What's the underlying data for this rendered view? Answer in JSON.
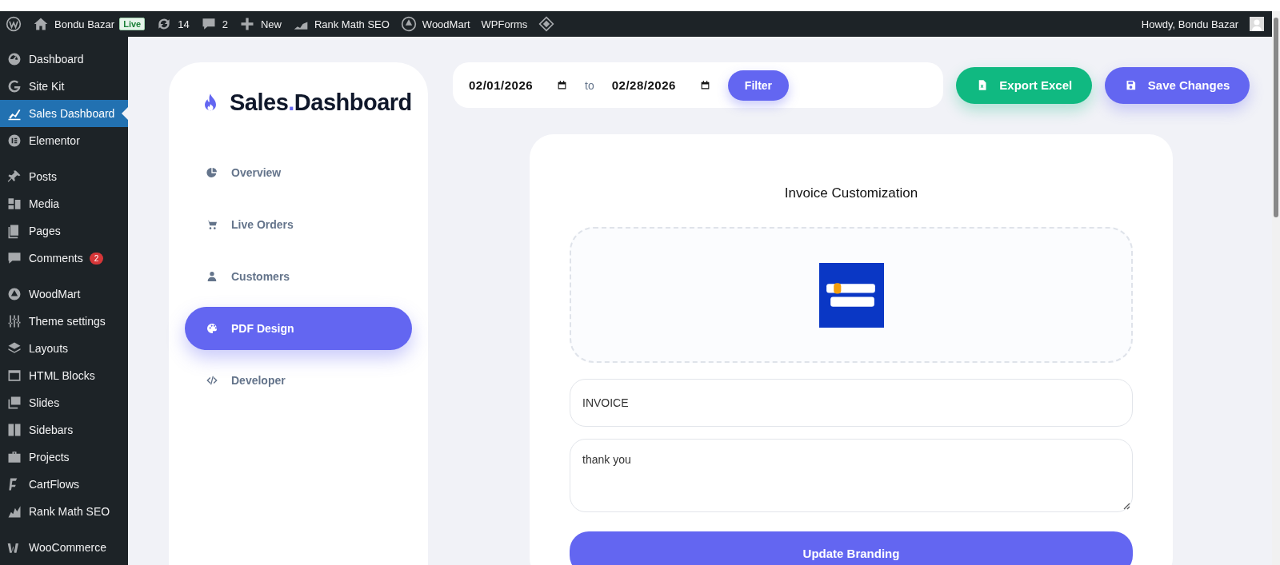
{
  "admin_bar": {
    "site": "Bondu Bazar",
    "live_badge": "Live",
    "updates": "14",
    "comments": "2",
    "new": "New",
    "links": [
      "Rank Math SEO",
      "WoodMart",
      "WPForms"
    ],
    "greeting": "Howdy, Bondu Bazar"
  },
  "admin_menu": [
    {
      "items": [
        {
          "label": "Dashboard",
          "selected": false
        },
        {
          "label": "Site Kit",
          "selected": false
        },
        {
          "label": "Sales Dashboard",
          "selected": true
        },
        {
          "label": "Elementor",
          "selected": false
        }
      ]
    },
    {
      "items": [
        {
          "label": "Posts",
          "selected": false
        },
        {
          "label": "Media",
          "selected": false
        },
        {
          "label": "Pages",
          "selected": false
        },
        {
          "label": "Comments",
          "selected": false,
          "badge": "2"
        }
      ]
    },
    {
      "items": [
        {
          "label": "WoodMart",
          "selected": false
        },
        {
          "label": "Theme settings",
          "selected": false
        },
        {
          "label": "Layouts",
          "selected": false
        },
        {
          "label": "HTML Blocks",
          "selected": false
        },
        {
          "label": "Slides",
          "selected": false
        },
        {
          "label": "Sidebars",
          "selected": false
        },
        {
          "label": "Projects",
          "selected": false
        },
        {
          "label": "CartFlows",
          "selected": false
        },
        {
          "label": "Rank Math SEO",
          "selected": false
        }
      ]
    },
    {
      "items": [
        {
          "label": "WooCommerce",
          "selected": false
        }
      ]
    }
  ],
  "brand": {
    "first": "Sales",
    "dot": ".",
    "second": "Dashboard"
  },
  "nav": [
    {
      "label": "Overview",
      "selected": false
    },
    {
      "label": "Live Orders",
      "selected": false
    },
    {
      "label": "Customers",
      "selected": false
    },
    {
      "label": "PDF Design",
      "selected": true
    },
    {
      "label": "Developer",
      "selected": false
    }
  ],
  "filter": {
    "from": "02/01/2026",
    "separator": "to",
    "to": "02/28/2026",
    "button": "Filter"
  },
  "actions": [
    {
      "label": "Export Excel",
      "kind": "export"
    },
    {
      "label": "Save Changes",
      "kind": "save"
    }
  ],
  "invoice": {
    "title": "Invoice Customization",
    "heading_value": "INVOICE",
    "note_value": "thank you",
    "button": "Update Branding"
  }
}
